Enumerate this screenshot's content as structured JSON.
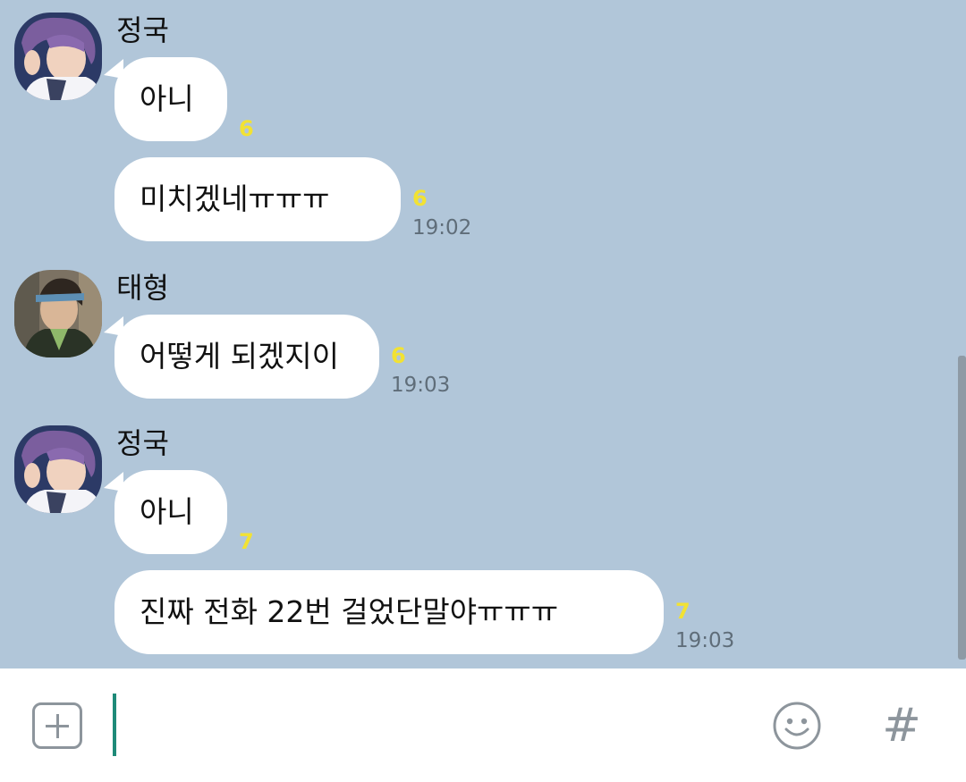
{
  "colors": {
    "chat_background": "#b1c6d9",
    "bubble": "#ffffff",
    "unread_count": "#f2e233",
    "timestamp": "#5f6d79",
    "caret": "#1e8a78",
    "input_icons": "#8d959c"
  },
  "messages": [
    {
      "sender": "정국",
      "avatar_icon": "profile-photo-jungkook",
      "bubbles": [
        {
          "text": "아니",
          "unread": "6",
          "time": ""
        },
        {
          "text": "미치겠네ㅠㅠㅠ",
          "unread": "6",
          "time": "19:02"
        }
      ]
    },
    {
      "sender": "태형",
      "avatar_icon": "profile-photo-taehyung",
      "bubbles": [
        {
          "text": "어떻게 되겠지이",
          "unread": "6",
          "time": "19:03"
        }
      ]
    },
    {
      "sender": "정국",
      "avatar_icon": "profile-photo-jungkook",
      "bubbles": [
        {
          "text": "아니",
          "unread": "7",
          "time": ""
        },
        {
          "text": "진짜 전화 22번 걸었단말야ㅠㅠㅠ",
          "unread": "7",
          "time": "19:03"
        }
      ]
    }
  ],
  "input_bar": {
    "plus_icon": "plus-square-icon",
    "message_value": "",
    "emoji_icon": "smiley-icon",
    "hash_icon": "hash-icon",
    "hash_glyph": "#"
  }
}
